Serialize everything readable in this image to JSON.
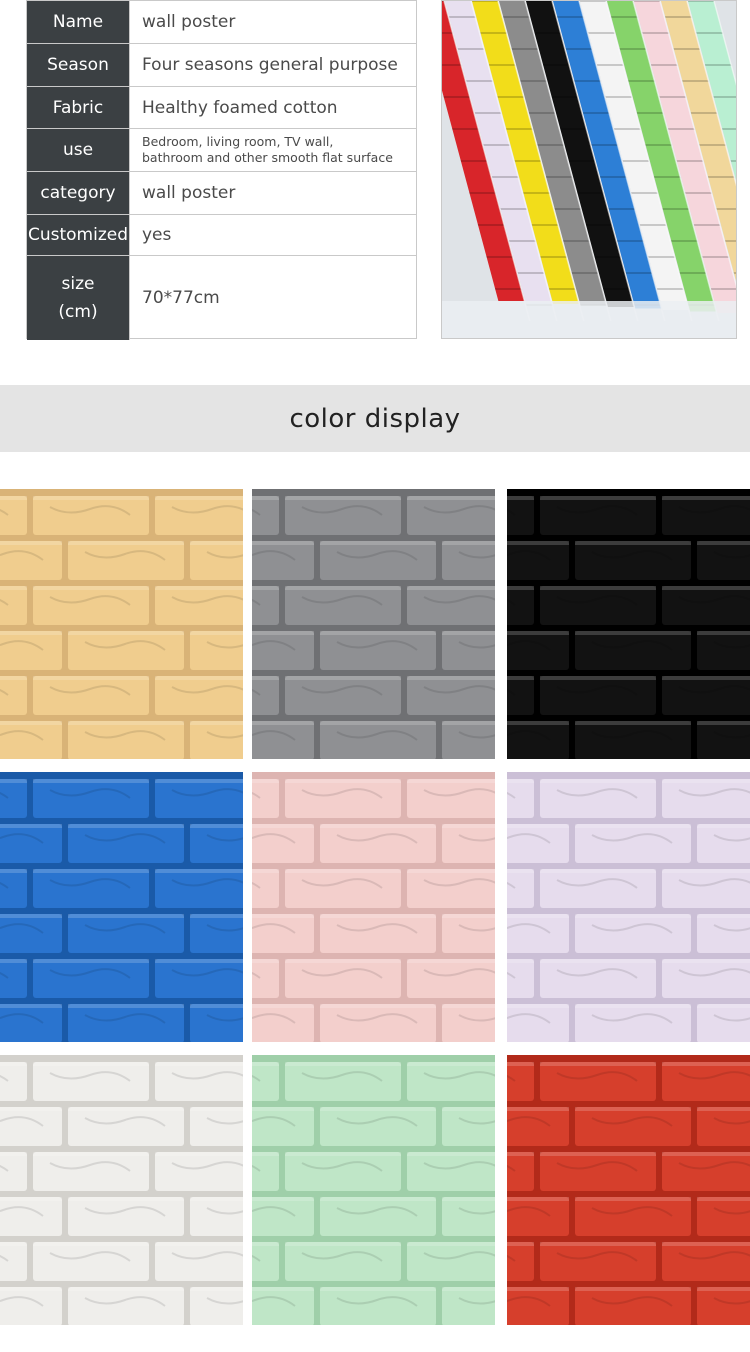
{
  "specs": [
    {
      "key": "Name",
      "value": "wall poster"
    },
    {
      "key": "Season",
      "value": "Four seasons general purpose"
    },
    {
      "key": "Fabric",
      "value": "Healthy foamed cotton"
    },
    {
      "key": "use",
      "value_line1": "Bedroom, living room, TV wall,",
      "value_line2": "bathroom and other smooth flat surface"
    },
    {
      "key": "category",
      "value": "wall poster"
    },
    {
      "key": "Customized",
      "value": "yes"
    },
    {
      "key_line1": "size",
      "key_line2": "(cm)",
      "value": "70*77cm"
    }
  ],
  "banner": {
    "title": "color display"
  },
  "hero_stack_colors": [
    "#d8252a",
    "#e8e0f0",
    "#f2dd1a",
    "#8c8c8c",
    "#111111",
    "#2d7fd6",
    "#f4f4f4",
    "#86d36a",
    "#f6d6dc",
    "#f1d79b",
    "#b9efd2"
  ],
  "swatch_colors": [
    {
      "name": "beige",
      "base": "#f0cd8e",
      "mortar": "#d9b377"
    },
    {
      "name": "gray",
      "base": "#8f9093",
      "mortar": "#6f7073"
    },
    {
      "name": "black",
      "base": "#121212",
      "mortar": "#000000"
    },
    {
      "name": "blue",
      "base": "#2a74cf",
      "mortar": "#1a5aa8"
    },
    {
      "name": "pink",
      "base": "#f3cfcc",
      "mortar": "#ddb4b1"
    },
    {
      "name": "lavender",
      "base": "#e6dced",
      "mortar": "#cbbfd6"
    },
    {
      "name": "white",
      "base": "#efeeeb",
      "mortar": "#d3d1cc"
    },
    {
      "name": "mint",
      "base": "#bfe6c7",
      "mortar": "#9fcfa9"
    },
    {
      "name": "red",
      "base": "#d63f2c",
      "mortar": "#b22a1a"
    }
  ]
}
